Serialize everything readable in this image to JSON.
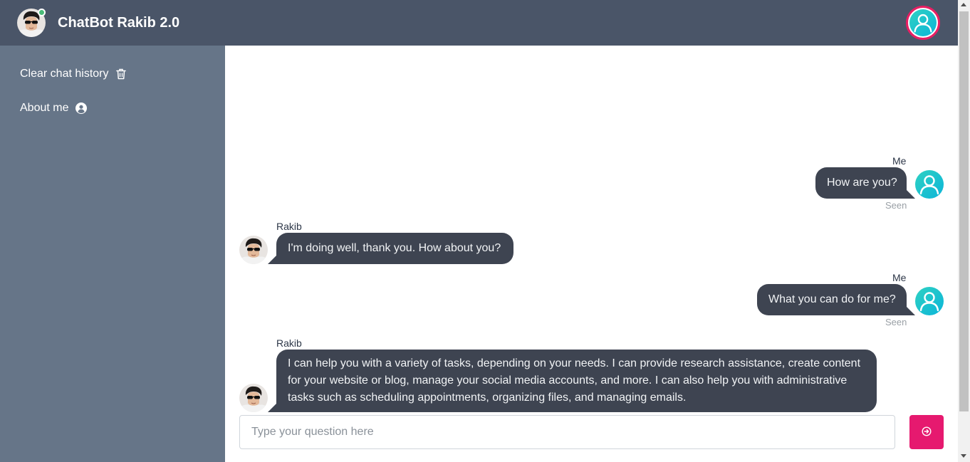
{
  "header": {
    "title": "ChatBot Rakib 2.0",
    "brand_avatar_icon": "bot-profile-photo",
    "status": "online",
    "user_avatar_icon": "user-avatar-icon",
    "colors": {
      "bar": "#4a5568",
      "online": "#48bb78",
      "avatar_ring": "#e91e63"
    }
  },
  "sidebar": {
    "items": [
      {
        "label": "Clear chat history",
        "icon": "trash-icon"
      },
      {
        "label": "About me",
        "icon": "user-circle-icon"
      }
    ]
  },
  "messages": [
    {
      "sender": "Me",
      "text": "How are you?",
      "status": "Seen",
      "from": "user"
    },
    {
      "sender": "Rakib",
      "text": "I'm doing well, thank you. How about you?",
      "from": "bot"
    },
    {
      "sender": "Me",
      "text": "What you can do for me?",
      "status": "Seen",
      "from": "user"
    },
    {
      "sender": "Rakib",
      "text": "I can help you with a variety of tasks, depending on your needs. I can provide research assistance, create content for your website or blog, manage your social media accounts, and more. I can also help you with administrative tasks such as scheduling appointments, organizing files, and managing emails.",
      "from": "bot"
    }
  ],
  "composer": {
    "placeholder": "Type your question here",
    "value": "",
    "send_icon": "arrow-circle-right-icon"
  },
  "colors": {
    "bubble": "#3e4451",
    "send": "#e6196f",
    "sidebar": "#667588"
  }
}
